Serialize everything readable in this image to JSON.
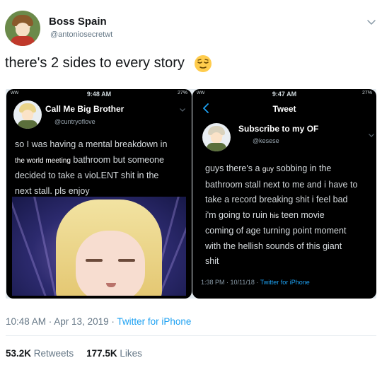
{
  "author": {
    "display_name": "Boss Spain",
    "handle": "@antoniosecretwt",
    "avatar_icon": "user-avatar"
  },
  "tweet": {
    "text": "there's 2 sides to every story",
    "emoji": "relieved-face-emoji",
    "timestamp": "10:48 AM · Apr 13, 2019 · ",
    "source": "Twitter for iPhone",
    "retweets_count": "53.2K",
    "retweets_label": "Retweets",
    "likes_count": "177.5K",
    "likes_label": "Likes"
  },
  "left_screenshot": {
    "status_time": "9:48 AM",
    "status_carrier": "WW",
    "status_battery": "27%",
    "name": "Call Me Big Brother",
    "handle": "@cuntryoflove",
    "line1": "so I was having a mental breakdown in",
    "line2_small": "the world meeting",
    "line2_rest": " bathroom but someone",
    "line3": "decided to take a vioLENT shit in the",
    "line4": "next stall. pls enjoy"
  },
  "right_screenshot": {
    "status_time": "9:47 AM",
    "status_carrier": "WW",
    "status_battery": "27%",
    "header": "Tweet",
    "name": "Subscribe to my OF",
    "handle": "@kesese",
    "line1_a": "guys there's a ",
    "line1_small": "guy",
    "line1_b": " sobbing in the",
    "line2": "bathroom stall next to me and i have to",
    "line3": "take a record breaking shit i feel bad",
    "line4_a": "i'm going to ruin ",
    "line4_small": "his",
    "line4_b": " teen movie",
    "line5": "coming of age turning point moment",
    "line6": "with the hellish sounds of this giant",
    "line7": "shit",
    "meta_time": "1:38 PM · 10/11/18 · ",
    "meta_source": "Twitter for iPhone"
  },
  "colors": {
    "link": "#1da1f2",
    "muted": "#657786",
    "text": "#14171a",
    "dark_bg": "#000000"
  }
}
